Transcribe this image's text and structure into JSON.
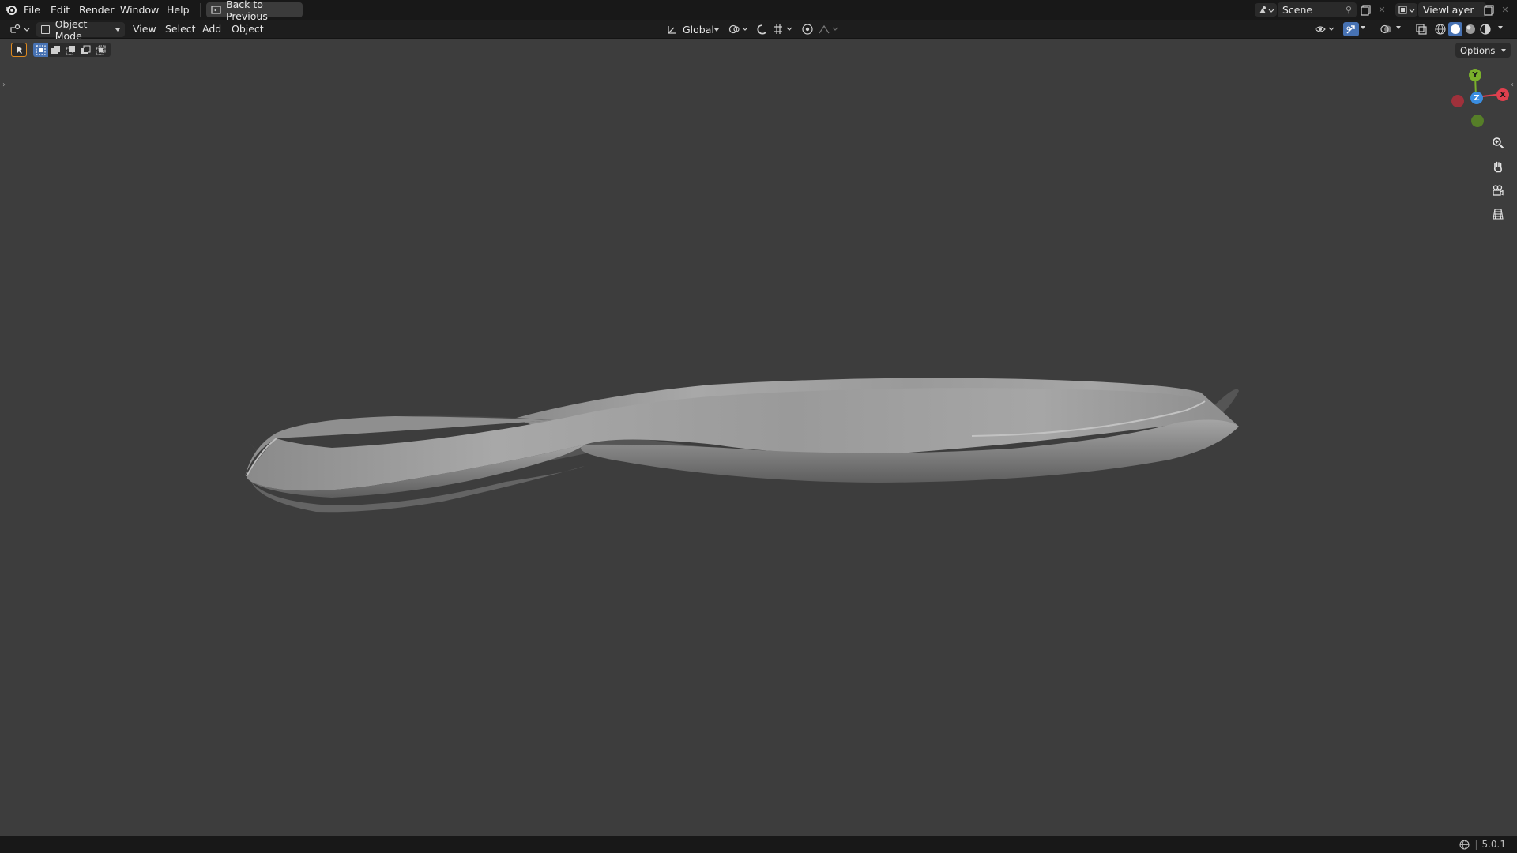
{
  "topbar": {
    "menu": [
      "File",
      "Edit",
      "Render",
      "Window",
      "Help"
    ],
    "back_button": "Back to Previous",
    "scene_field": "Scene",
    "viewlayer_field": "ViewLayer"
  },
  "header": {
    "mode": "Object Mode",
    "menu": [
      "View",
      "Select",
      "Add",
      "Object"
    ],
    "transform_orientation": "Global",
    "options_label": "Options"
  },
  "gizmo": {
    "x_label": "X",
    "y_label": "Y",
    "z_label": "Z",
    "colors": {
      "x": "#e0404e",
      "y": "#7ab12b",
      "z": "#3a8de0",
      "neg_x": "#b02f3b",
      "neg_y": "#5b8a24"
    }
  },
  "status": {
    "version": "5.0.1"
  },
  "colors": {
    "bg_viewport": "#3d3d3d",
    "bg_topbar": "#181818",
    "accent_select": "#4772b3"
  }
}
